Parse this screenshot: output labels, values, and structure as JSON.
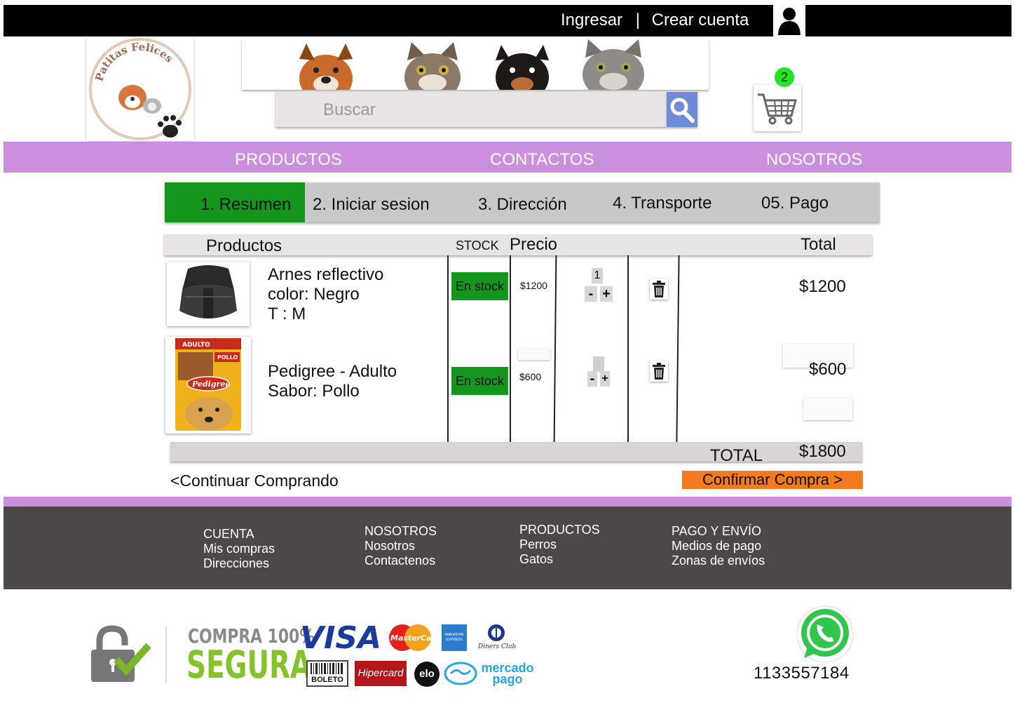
{
  "top_bar": {
    "login": "Ingresar",
    "separator": "|",
    "register": "Crear cuenta"
  },
  "header": {
    "logo_text": "Patitas Felices",
    "search": {
      "placeholder": "Buscar"
    },
    "cart_count": "2"
  },
  "nav": {
    "items": [
      "PRODUCTOS",
      "CONTACTOS",
      "NOSOTROS"
    ]
  },
  "steps": [
    "1. Resumen",
    "2. Iniciar sesion",
    "3. Dirección",
    "4. Transporte",
    "05. Pago"
  ],
  "table": {
    "headers": {
      "products": "Productos",
      "stock": "STOCK",
      "price": "Precio",
      "total": "Total"
    },
    "rows": [
      {
        "lines": [
          "Arnes reflectivo",
          "color: Negro",
          "T : M"
        ],
        "stock": "En stock",
        "price": "$1200",
        "qty": "1",
        "minus": "-",
        "plus": "+",
        "total": "$1200"
      },
      {
        "lines": [
          "Pedigree - Adulto",
          "Sabor: Pollo"
        ],
        "stock": "En stock",
        "price": "$600",
        "qty": "",
        "minus": "-",
        "plus": "+",
        "total": "$600",
        "pack": {
          "tag": "ADULTO",
          "flavor": "POLLO",
          "brand": "Pedigree"
        }
      }
    ],
    "total_label": "TOTAL",
    "total_value": "$1800"
  },
  "actions": {
    "continue": "<Continuar Comprando",
    "confirm": "Confirmar Compra >"
  },
  "footer": {
    "columns": [
      {
        "title": "CUENTA",
        "links": [
          "Mis compras",
          "Direcciones"
        ]
      },
      {
        "title": "NOSOTROS",
        "links": [
          "Nosotros",
          "Contactenos"
        ]
      },
      {
        "title": "PRODUCTOS",
        "links": [
          "Perros",
          "Gatos"
        ]
      },
      {
        "title": "PAGO Y ENVÍO",
        "links": [
          "Medios de pago",
          "Zonas de envíos"
        ]
      }
    ]
  },
  "security": {
    "line1": "COMPRA 100%",
    "line2": "SEGURA",
    "payments": {
      "visa": "VISA",
      "mastercard": "MasterCard",
      "amex": "AMERICAN EXPRESS",
      "diners": "Diners Club",
      "boleto": "BOLETO",
      "hipercard": "Hipercard",
      "elo": "elo",
      "mercado1": "mercado",
      "mercado2": "pago"
    }
  },
  "whatsapp": {
    "phone": "1133557184"
  },
  "colors": {
    "nav": "#cc8fde",
    "step_active": "#14961e",
    "confirm": "#f47a1f",
    "footer": "#4d4848",
    "badge": "#22e622",
    "search_btn": "#6f8ad8"
  }
}
